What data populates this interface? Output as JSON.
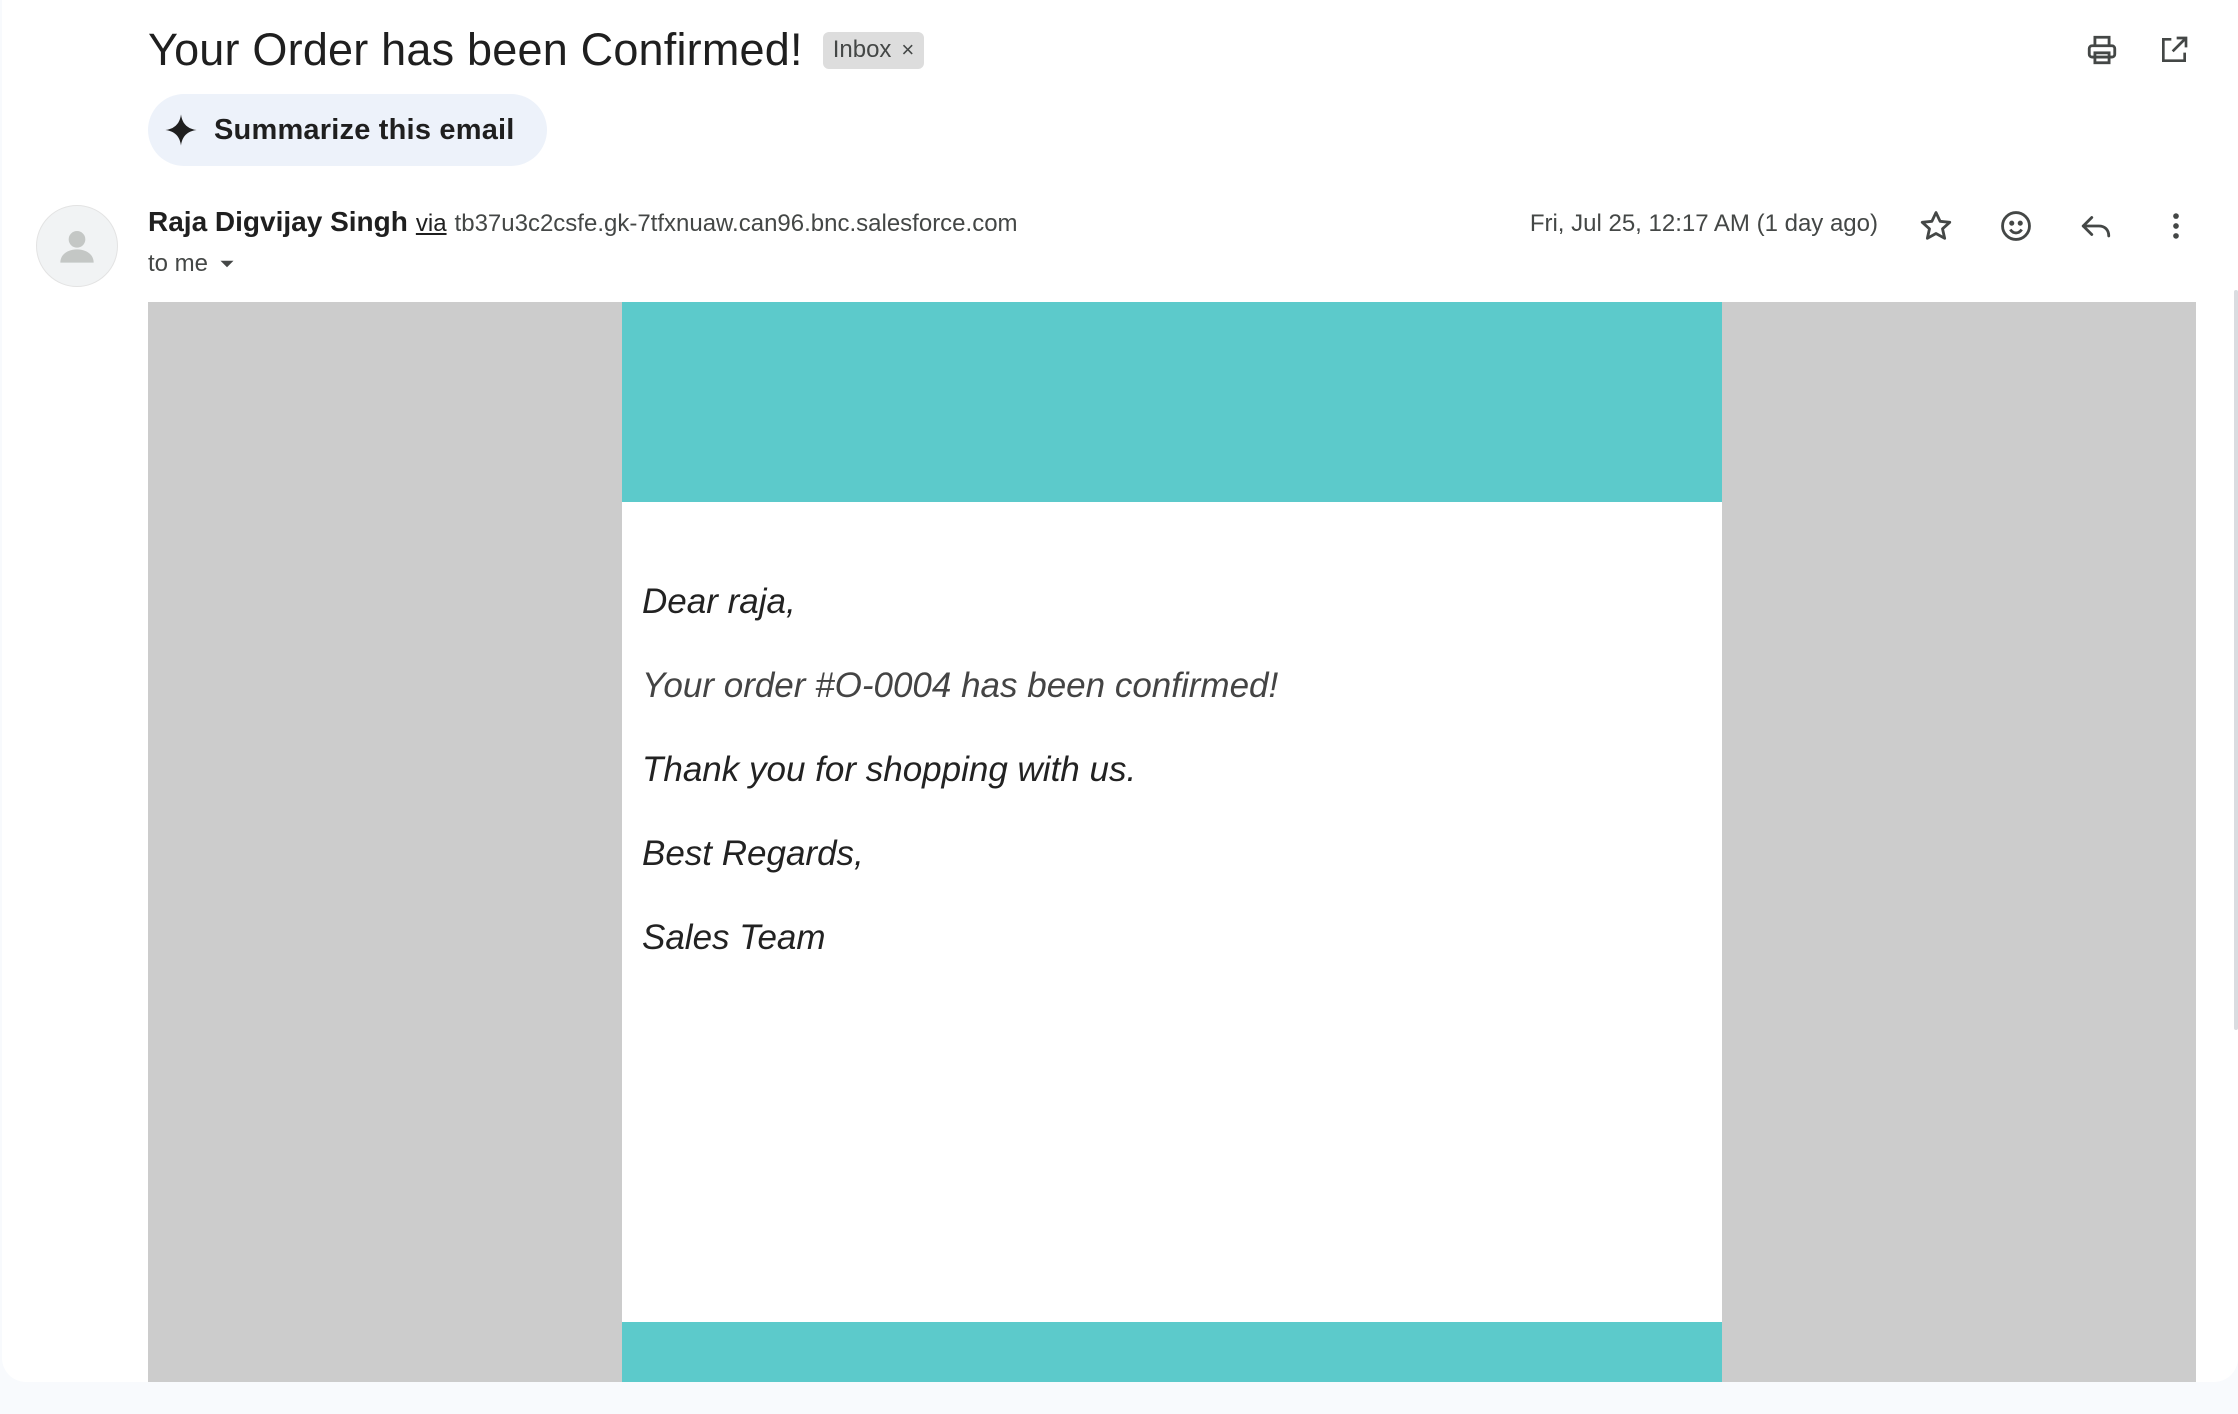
{
  "email": {
    "subject": "Your Order has been Confirmed!",
    "label": "Inbox",
    "label_remove": "×",
    "summarize_label": "Summarize this email",
    "sender_name": "Raja Digvijay Singh",
    "via": "via",
    "sender_domain": "tb37u3c2csfe.gk-7tfxnuaw.can96.bnc.salesforce.com",
    "recipient": "to me",
    "date": "Fri, Jul 25, 12:17 AM (1 day ago)"
  },
  "body": {
    "greeting": "Dear raja,",
    "order_line": "Your order #O-0004 has been confirmed!",
    "thanks": "Thank you for shopping with us.",
    "closing": "Best Regards,",
    "signature": "Sales Team"
  },
  "colors": {
    "accent_teal": "#5ccacb",
    "outer_gray": "#cccccc",
    "chip_bg": "#dddddd",
    "summarize_bg": "#edf2fa"
  },
  "icons": {
    "print": "print-icon",
    "open_new_window": "open-in-new-window-icon",
    "sparkle": "sparkle-icon",
    "avatar": "person-icon",
    "dropdown": "caret-down-icon",
    "star": "star-icon",
    "emoji": "emoji-reaction-icon",
    "reply": "reply-icon",
    "more": "more-vert-icon"
  }
}
